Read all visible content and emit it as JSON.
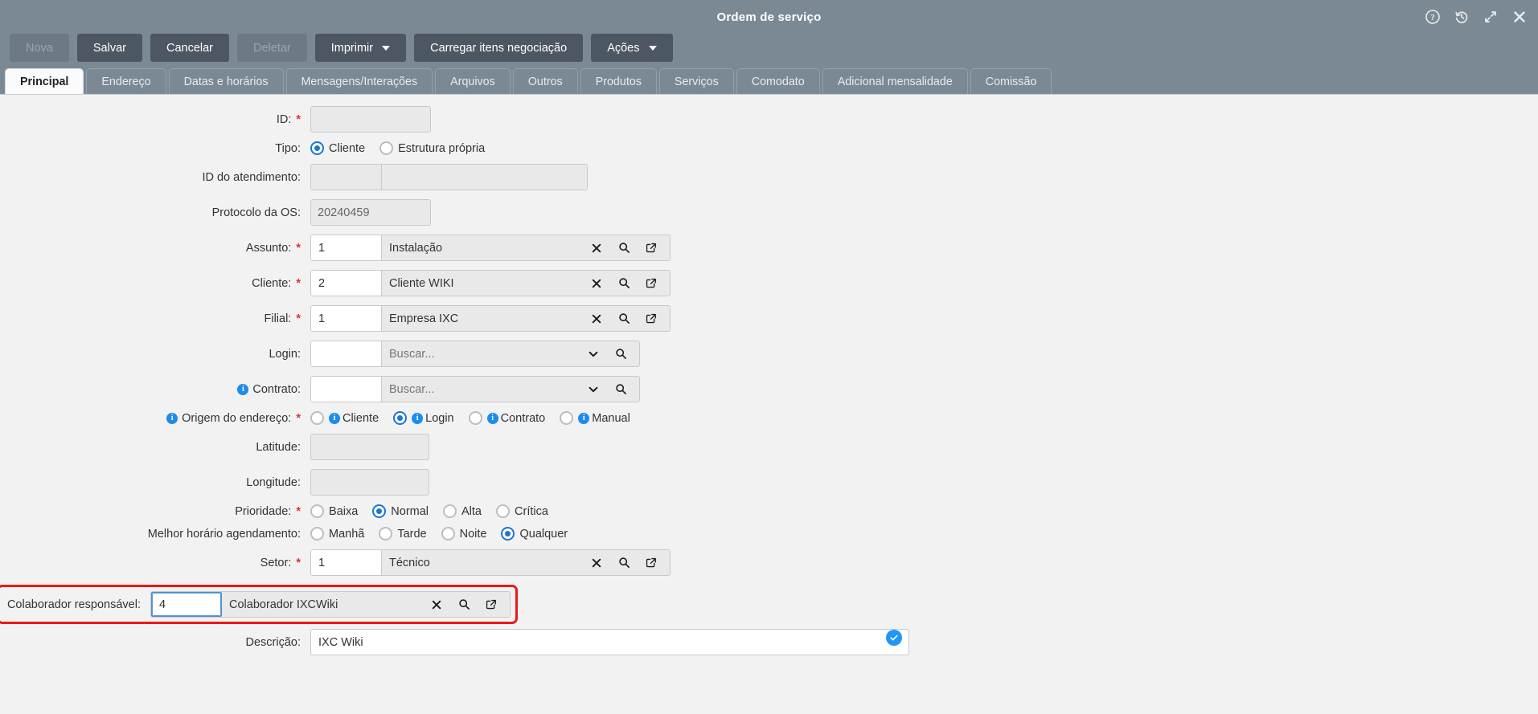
{
  "window": {
    "title": "Ordem de serviço",
    "icons": [
      {
        "name": "help-icon",
        "glyph": "?"
      },
      {
        "name": "history-icon",
        "glyph": "history"
      },
      {
        "name": "expand-icon",
        "glyph": "expand"
      },
      {
        "name": "close-icon",
        "glyph": "x"
      }
    ]
  },
  "toolbar": {
    "buttons": [
      {
        "label": "Nova",
        "disabled": true,
        "dropdown": false
      },
      {
        "label": "Salvar",
        "disabled": false,
        "dropdown": false
      },
      {
        "label": "Cancelar",
        "disabled": false,
        "dropdown": false
      },
      {
        "label": "Deletar",
        "disabled": true,
        "dropdown": false
      },
      {
        "label": "Imprimir",
        "disabled": false,
        "dropdown": true
      },
      {
        "label": "Carregar itens negociação",
        "disabled": false,
        "dropdown": false
      },
      {
        "label": "Ações",
        "disabled": false,
        "dropdown": true
      }
    ]
  },
  "tabs": [
    {
      "label": "Principal",
      "active": true
    },
    {
      "label": "Endereço",
      "active": false
    },
    {
      "label": "Datas e horários",
      "active": false
    },
    {
      "label": "Mensagens/Interações",
      "active": false
    },
    {
      "label": "Arquivos",
      "active": false
    },
    {
      "label": "Outros",
      "active": false
    },
    {
      "label": "Produtos",
      "active": false
    },
    {
      "label": "Serviços",
      "active": false
    },
    {
      "label": "Comodato",
      "active": false
    },
    {
      "label": "Adicional mensalidade",
      "active": false
    },
    {
      "label": "Comissão",
      "active": false
    }
  ],
  "form": {
    "id": {
      "label": "ID:",
      "required": "*",
      "value": ""
    },
    "tipo": {
      "label": "Tipo:",
      "options": [
        {
          "label": "Cliente",
          "selected": true
        },
        {
          "label": "Estrutura própria",
          "selected": false
        }
      ]
    },
    "id_atendimento": {
      "label": "ID do atendimento:",
      "code": "",
      "desc": ""
    },
    "protocolo": {
      "label": "Protocolo da OS:",
      "value": "20240459"
    },
    "assunto": {
      "label": "Assunto:",
      "required": "*",
      "code": "1",
      "desc": "Instalação"
    },
    "cliente": {
      "label": "Cliente:",
      "required": "*",
      "code": "2",
      "desc": "Cliente WIKI"
    },
    "filial": {
      "label": "Filial:",
      "required": "*",
      "code": "1",
      "desc": "Empresa IXC"
    },
    "login": {
      "label": "Login:",
      "code": "",
      "placeholder": "Buscar..."
    },
    "contrato": {
      "label": "Contrato:",
      "code": "",
      "placeholder": "Buscar..."
    },
    "origem_endereco": {
      "label": "Origem do endereço:",
      "required": "*",
      "options": [
        {
          "label": "Cliente",
          "selected": false,
          "info": true
        },
        {
          "label": "Login",
          "selected": true,
          "info": true
        },
        {
          "label": "Contrato",
          "selected": false,
          "info": true
        },
        {
          "label": "Manual",
          "selected": false,
          "info": true
        }
      ]
    },
    "latitude": {
      "label": "Latitude:",
      "value": ""
    },
    "longitude": {
      "label": "Longitude:",
      "value": ""
    },
    "prioridade": {
      "label": "Prioridade:",
      "required": "*",
      "options": [
        {
          "label": "Baixa",
          "selected": false
        },
        {
          "label": "Normal",
          "selected": true
        },
        {
          "label": "Alta",
          "selected": false
        },
        {
          "label": "Crítica",
          "selected": false
        }
      ]
    },
    "melhor_horario": {
      "label": "Melhor horário agendamento:",
      "options": [
        {
          "label": "Manhã",
          "selected": false
        },
        {
          "label": "Tarde",
          "selected": false
        },
        {
          "label": "Noite",
          "selected": false
        },
        {
          "label": "Qualquer",
          "selected": true
        }
      ]
    },
    "setor": {
      "label": "Setor:",
      "required": "*",
      "code": "1",
      "desc": "Técnico"
    },
    "colaborador": {
      "label": "Colaborador responsável:",
      "code": "4",
      "desc": "Colaborador IXCWiki",
      "highlighted": true,
      "focused": true
    },
    "descricao": {
      "label": "Descrição:",
      "value": "IXC Wiki"
    }
  },
  "colors": {
    "header_bg": "#7b8994",
    "button_bg": "#4d5763",
    "accent": "#1c8ced",
    "highlight_border": "#e81a1a",
    "required": "#e03030"
  }
}
